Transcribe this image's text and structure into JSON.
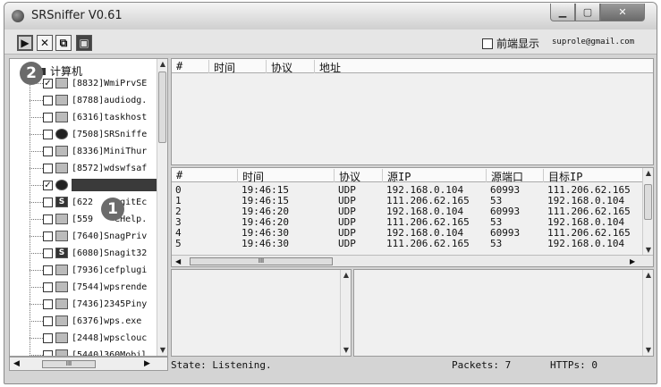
{
  "window": {
    "title": "SRSniffer V0.61",
    "minimize": "▁",
    "maximize": "▢",
    "close": "✕"
  },
  "toolbar": {
    "start_glyph": "▶",
    "stop_glyph": "✕",
    "clear_glyph": "⧉",
    "snapshot_glyph": "▣",
    "topmost_label": "前端显示",
    "topmost_checked": false,
    "email": "suprole@gmail.com"
  },
  "process_tree": {
    "root_label": "计算机",
    "items": [
      {
        "label": "[8832]WmiPrvSE",
        "checked": true,
        "icon": "window-icon"
      },
      {
        "label": "[8788]audiodg.",
        "checked": false,
        "icon": "window-icon"
      },
      {
        "label": "[6316]taskhost",
        "checked": false,
        "icon": "window-icon"
      },
      {
        "label": "[7508]SRSniffe",
        "checked": false,
        "icon": "sniffer-icon"
      },
      {
        "label": "[8336]MiniThur",
        "checked": false,
        "icon": "window-icon"
      },
      {
        "label": "[8572]wdswfsaf",
        "checked": false,
        "icon": "shield-icon"
      },
      {
        "label": "",
        "checked": true,
        "icon": "browser-icon",
        "selected": true
      },
      {
        "label": "[622",
        "suffix": "agitEc",
        "checked": false,
        "icon": "snagit-icon"
      },
      {
        "label": "[559",
        "suffix": "eHelp.",
        "checked": false,
        "icon": "window-icon"
      },
      {
        "label": "[7640]SnagPriv",
        "checked": false,
        "icon": "window-icon"
      },
      {
        "label": "[6080]Snagit32",
        "checked": false,
        "icon": "snagit-icon"
      },
      {
        "label": "[7936]cefplugi",
        "checked": false,
        "icon": "window-icon"
      },
      {
        "label": "[7544]wpsrende",
        "checked": false,
        "icon": "cloud-icon"
      },
      {
        "label": "[7436]2345Piny",
        "checked": false,
        "icon": "gear-icon"
      },
      {
        "label": "[6376]wps.exe",
        "checked": false,
        "icon": "wps-icon"
      },
      {
        "label": "[2448]wpsclouc",
        "checked": false,
        "icon": "cloud-icon"
      },
      {
        "label": "[5440]360Mobil",
        "checked": false,
        "icon": "app-icon"
      }
    ]
  },
  "badges": {
    "one": "1",
    "two": "2"
  },
  "top_grid": {
    "headers": [
      "#",
      "时间",
      "协议",
      "地址"
    ]
  },
  "packet_grid": {
    "headers": [
      "#",
      "时间",
      "协议",
      "源IP",
      "源端口",
      "目标IP"
    ],
    "rows": [
      {
        "n": "0",
        "time": "19:46:15",
        "proto": "UDP",
        "src_ip": "192.168.0.104",
        "src_port": "60993",
        "dst_ip": "111.206.62.165"
      },
      {
        "n": "1",
        "time": "19:46:15",
        "proto": "UDP",
        "src_ip": "111.206.62.165",
        "src_port": "53",
        "dst_ip": "192.168.0.104"
      },
      {
        "n": "2",
        "time": "19:46:20",
        "proto": "UDP",
        "src_ip": "192.168.0.104",
        "src_port": "60993",
        "dst_ip": "111.206.62.165"
      },
      {
        "n": "3",
        "time": "19:46:20",
        "proto": "UDP",
        "src_ip": "111.206.62.165",
        "src_port": "53",
        "dst_ip": "192.168.0.104"
      },
      {
        "n": "4",
        "time": "19:46:30",
        "proto": "UDP",
        "src_ip": "192.168.0.104",
        "src_port": "60993",
        "dst_ip": "111.206.62.165"
      },
      {
        "n": "5",
        "time": "19:46:30",
        "proto": "UDP",
        "src_ip": "111.206.62.165",
        "src_port": "53",
        "dst_ip": "192.168.0.104"
      }
    ]
  },
  "scroll": {
    "thumb_glyph": "III",
    "up": "▲",
    "down": "▼",
    "left": "◀",
    "right": "▶"
  },
  "status": {
    "state": "State: Listening.",
    "packets": "Packets: 7",
    "https": "HTTPs: 0"
  }
}
